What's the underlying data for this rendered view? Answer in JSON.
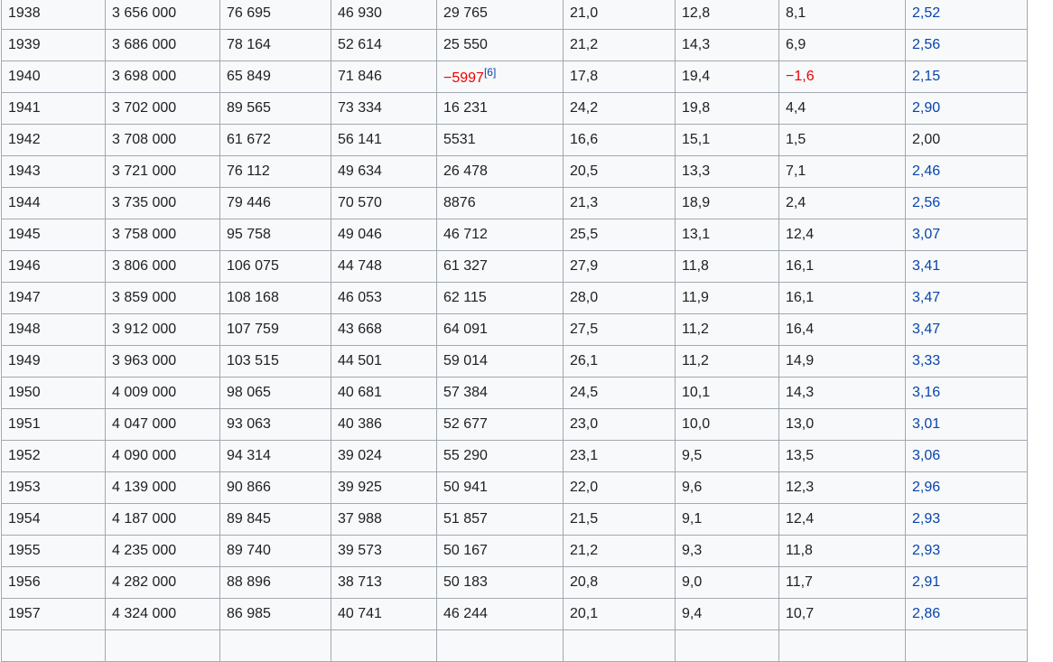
{
  "table": {
    "rows": [
      {
        "year": "1938",
        "population": "3 656 000",
        "births": "76 695",
        "deaths": "46 930",
        "natural_change": "29 765",
        "birth_rate": "21,0",
        "death_rate": "12,8",
        "natural_change_rate": "8,1",
        "fertility_rate": "2,52"
      },
      {
        "year": "1939",
        "population": "3 686 000",
        "births": "78 164",
        "deaths": "52 614",
        "natural_change": "25 550",
        "birth_rate": "21,2",
        "death_rate": "14,3",
        "natural_change_rate": "6,9",
        "fertility_rate": "2,56"
      },
      {
        "year": "1940",
        "population": "3 698 000",
        "births": "65 849",
        "deaths": "71 846",
        "natural_change": "−5997",
        "natural_change_ref": "[6]",
        "natural_change_negative": true,
        "birth_rate": "17,8",
        "death_rate": "19,4",
        "natural_change_rate": "−1,6",
        "natural_change_rate_negative": true,
        "fertility_rate": "2,15"
      },
      {
        "year": "1941",
        "population": "3 702 000",
        "births": "89 565",
        "deaths": "73 334",
        "natural_change": "16 231",
        "birth_rate": "24,2",
        "death_rate": "19,8",
        "natural_change_rate": "4,4",
        "fertility_rate": "2,90"
      },
      {
        "year": "1942",
        "population": "3 708 000",
        "births": "61 672",
        "deaths": "56 141",
        "natural_change": "5531",
        "birth_rate": "16,6",
        "death_rate": "15,1",
        "natural_change_rate": "1,5",
        "fertility_rate": "2,00",
        "fertility_rate_plain": true
      },
      {
        "year": "1943",
        "population": "3 721 000",
        "births": "76 112",
        "deaths": "49 634",
        "natural_change": "26 478",
        "birth_rate": "20,5",
        "death_rate": "13,3",
        "natural_change_rate": "7,1",
        "fertility_rate": "2,46"
      },
      {
        "year": "1944",
        "population": "3 735 000",
        "births": "79 446",
        "deaths": "70 570",
        "natural_change": "8876",
        "birth_rate": "21,3",
        "death_rate": "18,9",
        "natural_change_rate": "2,4",
        "fertility_rate": "2,56"
      },
      {
        "year": "1945",
        "population": "3 758 000",
        "births": "95 758",
        "deaths": "49 046",
        "natural_change": "46 712",
        "birth_rate": "25,5",
        "death_rate": "13,1",
        "natural_change_rate": "12,4",
        "fertility_rate": "3,07"
      },
      {
        "year": "1946",
        "population": "3 806 000",
        "births": "106 075",
        "deaths": "44 748",
        "natural_change": "61 327",
        "birth_rate": "27,9",
        "death_rate": "11,8",
        "natural_change_rate": "16,1",
        "fertility_rate": "3,41"
      },
      {
        "year": "1947",
        "population": "3 859 000",
        "births": "108 168",
        "deaths": "46 053",
        "natural_change": "62 115",
        "birth_rate": "28,0",
        "death_rate": "11,9",
        "natural_change_rate": "16,1",
        "fertility_rate": "3,47"
      },
      {
        "year": "1948",
        "population": "3 912 000",
        "births": "107 759",
        "deaths": "43 668",
        "natural_change": "64 091",
        "birth_rate": "27,5",
        "death_rate": "11,2",
        "natural_change_rate": "16,4",
        "fertility_rate": "3,47"
      },
      {
        "year": "1949",
        "population": "3 963 000",
        "births": "103 515",
        "deaths": "44 501",
        "natural_change": "59 014",
        "birth_rate": "26,1",
        "death_rate": "11,2",
        "natural_change_rate": "14,9",
        "fertility_rate": "3,33"
      },
      {
        "year": "1950",
        "population": "4 009 000",
        "births": "98 065",
        "deaths": "40 681",
        "natural_change": "57 384",
        "birth_rate": "24,5",
        "death_rate": "10,1",
        "natural_change_rate": "14,3",
        "fertility_rate": "3,16"
      },
      {
        "year": "1951",
        "population": "4 047 000",
        "births": "93 063",
        "deaths": "40 386",
        "natural_change": "52 677",
        "birth_rate": "23,0",
        "death_rate": "10,0",
        "natural_change_rate": "13,0",
        "fertility_rate": "3,01"
      },
      {
        "year": "1952",
        "population": "4 090 000",
        "births": "94 314",
        "deaths": "39 024",
        "natural_change": "55 290",
        "birth_rate": "23,1",
        "death_rate": "9,5",
        "natural_change_rate": "13,5",
        "fertility_rate": "3,06"
      },
      {
        "year": "1953",
        "population": "4 139 000",
        "births": "90 866",
        "deaths": "39 925",
        "natural_change": "50 941",
        "birth_rate": "22,0",
        "death_rate": "9,6",
        "natural_change_rate": "12,3",
        "fertility_rate": "2,96"
      },
      {
        "year": "1954",
        "population": "4 187 000",
        "births": "89 845",
        "deaths": "37 988",
        "natural_change": "51 857",
        "birth_rate": "21,5",
        "death_rate": "9,1",
        "natural_change_rate": "12,4",
        "fertility_rate": "2,93"
      },
      {
        "year": "1955",
        "population": "4 235 000",
        "births": "89 740",
        "deaths": "39 573",
        "natural_change": "50 167",
        "birth_rate": "21,2",
        "death_rate": "9,3",
        "natural_change_rate": "11,8",
        "fertility_rate": "2,93"
      },
      {
        "year": "1956",
        "population": "4 282 000",
        "births": "88 896",
        "deaths": "38 713",
        "natural_change": "50 183",
        "birth_rate": "20,8",
        "death_rate": "9,0",
        "natural_change_rate": "11,7",
        "fertility_rate": "2,91"
      },
      {
        "year": "1957",
        "population": "4 324 000",
        "births": "86 985",
        "deaths": "40 741",
        "natural_change": "46 244",
        "birth_rate": "20,1",
        "death_rate": "9,4",
        "natural_change_rate": "10,7",
        "fertility_rate": "2,86"
      }
    ]
  },
  "colors": {
    "link": "#0645ad",
    "negative": "#ee0000",
    "text": "#202122",
    "cell_background": "#f8f9fa",
    "border": "#a2a9b1"
  }
}
